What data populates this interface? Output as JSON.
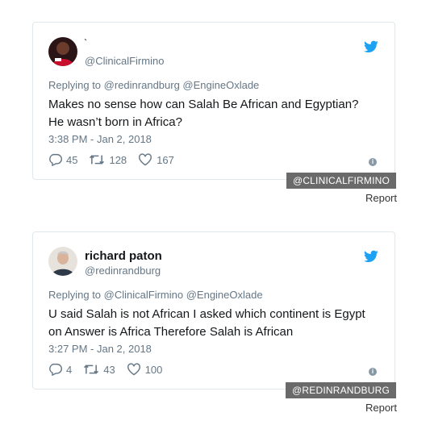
{
  "tweets": [
    {
      "name": "˞",
      "handle": "@ClinicalFirmino",
      "reply_prefix": "Replying to",
      "reply_handles": "@redinrandburg @EngineOxlade",
      "text_lines": [
        "Makes no sense how can Salah Be African and Egyptian?",
        "He wasn’t born in Africa?"
      ],
      "time": "3:38 PM - Jan 2, 2018",
      "replies": "45",
      "retweets": "128",
      "likes": "167",
      "badge": "@CLINICALFIRMINO",
      "report": "Report"
    },
    {
      "name": "richard paton",
      "handle": "@redinrandburg",
      "reply_prefix": "Replying to",
      "reply_handles": "@ClinicalFirmino @EngineOxlade",
      "text_lines": [
        "U said Salah is not African I asked which continent is Egypt",
        "on Answer is Africa Therefore Salah is African"
      ],
      "time": "3:27 PM - Jan 2, 2018",
      "replies": "4",
      "retweets": "43",
      "likes": "100",
      "badge": "@REDINRANDBURG",
      "report": "Report"
    }
  ],
  "colors": {
    "twitter_blue": "#1da1f2",
    "muted": "#657786",
    "badge_bg": "#6a6a6a"
  },
  "icons": [
    "twitter-bird-icon",
    "reply-icon",
    "retweet-icon",
    "like-icon",
    "info-icon"
  ]
}
